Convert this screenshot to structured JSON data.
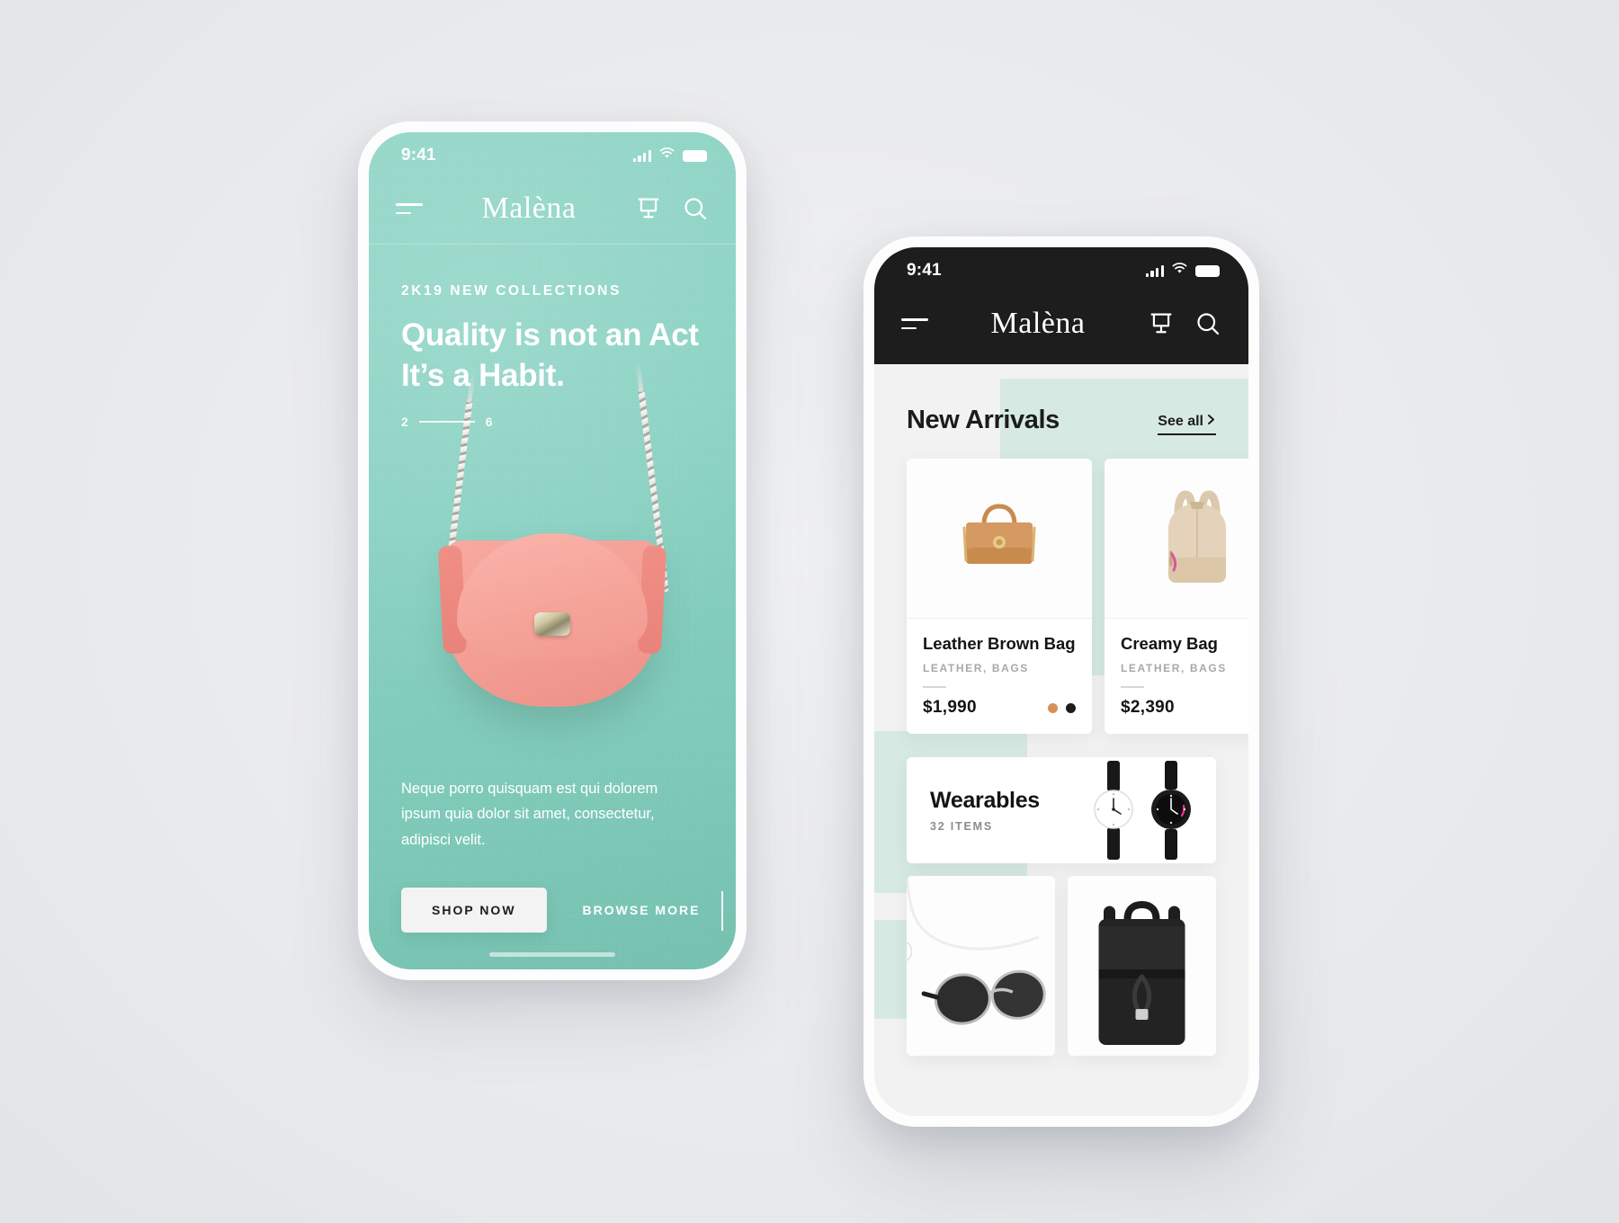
{
  "app": {
    "brand": "Malèna",
    "accent_mint": "#8ed5c5",
    "accent_mint_light": "#d7e9e3",
    "dark": "#1d1d1d",
    "pink": "#f5a399"
  },
  "phone1": {
    "status": {
      "time": "9:41",
      "signal_icon": "cellular-bars-icon",
      "wifi_icon": "wifi-icon",
      "battery_icon": "battery-icon"
    },
    "nav": {
      "menu_icon": "hamburger-menu-icon",
      "brand": "Malèna",
      "cart_icon": "shopping-cart-icon",
      "search_icon": "search-icon"
    },
    "hero": {
      "eyebrow": "2K19 NEW COLLECTIONS",
      "headline_line1": "Quality is not an Act",
      "headline_line2": "It’s a Habit.",
      "pager_current": "2",
      "pager_total": "6",
      "paragraph": "Neque porro quisquam est qui dolorem ipsum quia dolor sit amet, consectetur, adipisci velit.",
      "primary_cta": "SHOP NOW",
      "secondary_cta": "BROWSE MORE",
      "product_image_alt": "pink-crossbody-bag"
    }
  },
  "phone2": {
    "status": {
      "time": "9:41",
      "signal_icon": "cellular-bars-icon",
      "wifi_icon": "wifi-icon",
      "battery_icon": "battery-icon"
    },
    "nav": {
      "menu_icon": "hamburger-menu-icon",
      "brand": "Malèna",
      "cart_icon": "shopping-cart-icon",
      "search_icon": "search-icon"
    },
    "section": {
      "title": "New Arrivals",
      "see_all": "See all",
      "see_all_chevron": "chevron-right-icon"
    },
    "products": [
      {
        "name": "Leather Brown Bag",
        "category": "LEATHER, BAGS",
        "price": "$1,990",
        "image_alt": "brown-leather-handbag",
        "swatches": [
          "#d98f53",
          "#1c1c1c"
        ]
      },
      {
        "name": "Creamy Bag",
        "category": "LEATHER, BAGS",
        "price": "$2,390",
        "image_alt": "cream-backpack",
        "swatches": []
      }
    ],
    "category_card": {
      "title": "Wearables",
      "count": "32 ITEMS",
      "image_alt": "two-wristwatches"
    },
    "bottom_tiles": [
      {
        "image_alt": "sunglasses-and-earphones"
      },
      {
        "image_alt": "black-leather-backpack"
      }
    ]
  }
}
